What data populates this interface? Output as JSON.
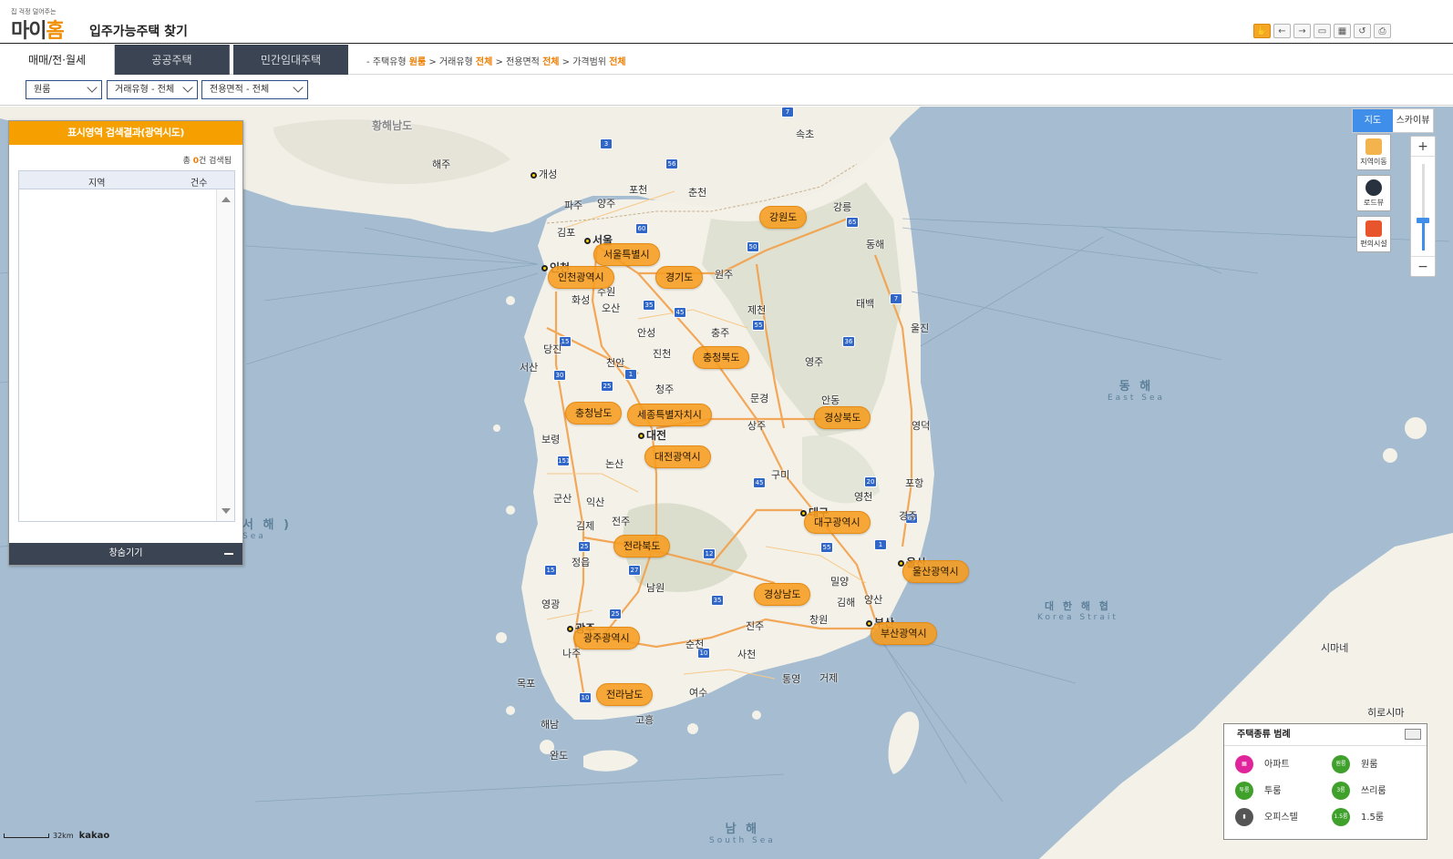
{
  "header": {
    "logo_tagline": "집 걱정 덜어주는",
    "logo_text_1": "마이",
    "logo_text_2": "홈",
    "title": "입주가능주택 찾기",
    "tools": [
      "pan-hand-icon",
      "back-arrow-icon",
      "forward-arrow-icon",
      "measure-distance-icon",
      "measure-area-icon",
      "reset-icon",
      "print-icon"
    ]
  },
  "tabs": [
    {
      "label": "매매/전·월세",
      "active": true
    },
    {
      "label": "공공주택",
      "active": false
    },
    {
      "label": "민간임대주택",
      "active": false
    }
  ],
  "breadcrumb": {
    "p1": "- 주택유형",
    "v1": "원룸",
    "p2": " > 거래유형",
    "v2": "전체",
    "p3": " > 전용면적",
    "v3": "전체",
    "p4": " > 가격범위",
    "v4": "전체"
  },
  "filters": {
    "housing_type": "원룸",
    "deal_type": "거래유형 - 전체",
    "area": "전용면적 - 전체"
  },
  "result_panel": {
    "title": "표시영역 검색결과(광역시도)",
    "count_prefix": "총",
    "count_value": "0",
    "count_suffix": "건 검색됨",
    "col_region": "지역",
    "col_count": "건수",
    "footer": "창숨기기"
  },
  "map_controls": {
    "map_label": "지도",
    "skyview_label": "스카이뷰",
    "btn_move": "지역이동",
    "btn_roadview": "로드뷰",
    "btn_facility": "편의시설",
    "zoom_plus": "+",
    "zoom_minus": "−",
    "zoom_level_fraction": 0.65
  },
  "regions": [
    {
      "label": "서울특별시"
    },
    {
      "label": "인천광역시"
    },
    {
      "label": "경기도"
    },
    {
      "label": "강원도"
    },
    {
      "label": "충청북도"
    },
    {
      "label": "충청남도"
    },
    {
      "label": "세종특별자치시"
    },
    {
      "label": "대전광역시"
    },
    {
      "label": "경상북도"
    },
    {
      "label": "대구광역시"
    },
    {
      "label": "울산광역시"
    },
    {
      "label": "전라북도"
    },
    {
      "label": "경상남도"
    },
    {
      "label": "부산광역시"
    },
    {
      "label": "광주광역시"
    },
    {
      "label": "전라남도"
    }
  ],
  "cities": [
    {
      "label": "황해남도"
    },
    {
      "label": "개성"
    },
    {
      "label": "해주"
    },
    {
      "label": "서울"
    },
    {
      "label": "인천"
    },
    {
      "label": "김포"
    },
    {
      "label": "수원"
    },
    {
      "label": "화성"
    },
    {
      "label": "오산"
    },
    {
      "label": "원주"
    },
    {
      "label": "강릉"
    },
    {
      "label": "동해"
    },
    {
      "label": "속초"
    },
    {
      "label": "춘천"
    },
    {
      "label": "제천"
    },
    {
      "label": "충주"
    },
    {
      "label": "천안"
    },
    {
      "label": "청주"
    },
    {
      "label": "대전"
    },
    {
      "label": "서산"
    },
    {
      "label": "당진"
    },
    {
      "label": "보령"
    },
    {
      "label": "논산"
    },
    {
      "label": "군산"
    },
    {
      "label": "익산"
    },
    {
      "label": "전주"
    },
    {
      "label": "김제"
    },
    {
      "label": "정읍"
    },
    {
      "label": "남원"
    },
    {
      "label": "광주"
    },
    {
      "label": "나주"
    },
    {
      "label": "목포"
    },
    {
      "label": "여수"
    },
    {
      "label": "순천"
    },
    {
      "label": "진주"
    },
    {
      "label": "사천"
    },
    {
      "label": "통영"
    },
    {
      "label": "거제"
    },
    {
      "label": "창원"
    },
    {
      "label": "김해"
    },
    {
      "label": "양산"
    },
    {
      "label": "부산"
    },
    {
      "label": "울산"
    },
    {
      "label": "경주"
    },
    {
      "label": "포항"
    },
    {
      "label": "영천"
    },
    {
      "label": "대구"
    },
    {
      "label": "구미"
    },
    {
      "label": "안동"
    },
    {
      "label": "상주"
    },
    {
      "label": "문경"
    },
    {
      "label": "영주"
    },
    {
      "label": "밀양"
    },
    {
      "label": "태백"
    },
    {
      "label": "파주"
    },
    {
      "label": "양주"
    },
    {
      "label": "포천"
    },
    {
      "label": "안성"
    },
    {
      "label": "진천"
    },
    {
      "label": "완도"
    },
    {
      "label": "고흥"
    },
    {
      "label": "해남"
    },
    {
      "label": "영광"
    },
    {
      "label": "울진"
    },
    {
      "label": "영덕"
    },
    {
      "label": "시마네"
    },
    {
      "label": "히로시마"
    }
  ],
  "sea_labels": {
    "east": "동 해",
    "east_en": "East Sea",
    "west": "서 해 )",
    "west_en": "Sea",
    "south": "남 해",
    "south_en": "South Sea",
    "strait": "대 한 해 협",
    "strait_en": "Korea Strait"
  },
  "legend": {
    "title": "주택종류 범례",
    "items": [
      {
        "label": "아파트",
        "color": "#e0249c",
        "icon": "apartment-pin-icon"
      },
      {
        "label": "원룸",
        "color": "#3fa12c",
        "icon": "one-room-pin-icon",
        "badge": "원룸"
      },
      {
        "label": "투룸",
        "color": "#3fa12c",
        "icon": "two-room-pin-icon",
        "badge": "투룸"
      },
      {
        "label": "쓰리룸",
        "color": "#3fa12c",
        "icon": "three-room-pin-icon",
        "badge": "3룸"
      },
      {
        "label": "오피스텔",
        "color": "#555555",
        "icon": "officetel-pin-icon"
      },
      {
        "label": "1.5룸",
        "color": "#3fa12c",
        "icon": "one-half-room-pin-icon",
        "badge": "1.5룸"
      }
    ]
  },
  "scale": {
    "distance": "32km",
    "brand": "kakao"
  },
  "colors": {
    "accent": "#f5a000",
    "nav_dark": "#3b4452",
    "map_blue": "#3e8eea"
  }
}
